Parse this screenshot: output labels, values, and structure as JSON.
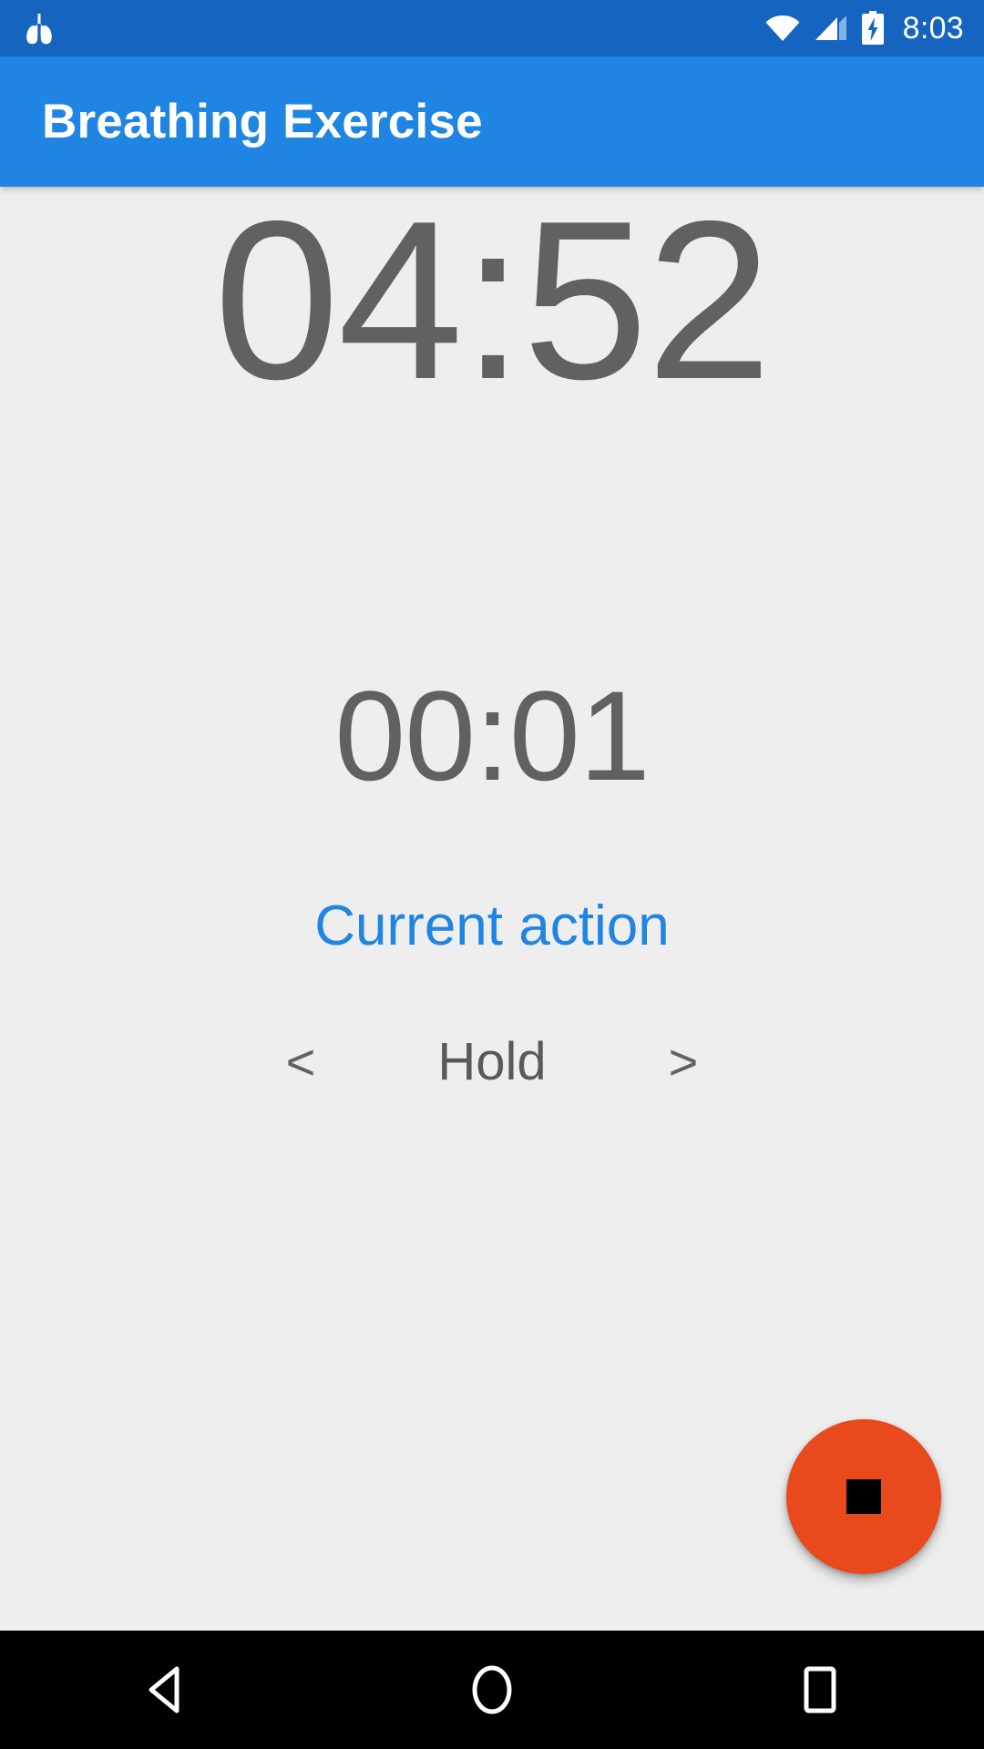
{
  "status_bar": {
    "app_icon": "lungs-icon",
    "wifi_icon": "wifi-full-icon",
    "signal_icon": "cellular-signal-partial-icon",
    "battery_icon": "battery-charging-icon",
    "time": "8:03",
    "background_color": "#1565C0"
  },
  "app_bar": {
    "title": "Breathing Exercise",
    "background_color": "#2085E2",
    "text_color": "#FFFFFF"
  },
  "main": {
    "total_timer": "04:52",
    "step_timer": "00:01",
    "current_action_label": "Current action",
    "current_action_color": "#2085E2",
    "prev_arrow": "<",
    "action_name": "Hold",
    "next_arrow": ">",
    "timer_color": "#616161",
    "background_color": "#EEEEEE"
  },
  "fab": {
    "icon": "stop-square-icon",
    "background_color": "#E8491D",
    "icon_color": "#000000"
  },
  "nav_bar": {
    "back": "back-triangle-icon",
    "home": "home-circle-icon",
    "recents": "recents-square-icon",
    "background_color": "#000000"
  }
}
